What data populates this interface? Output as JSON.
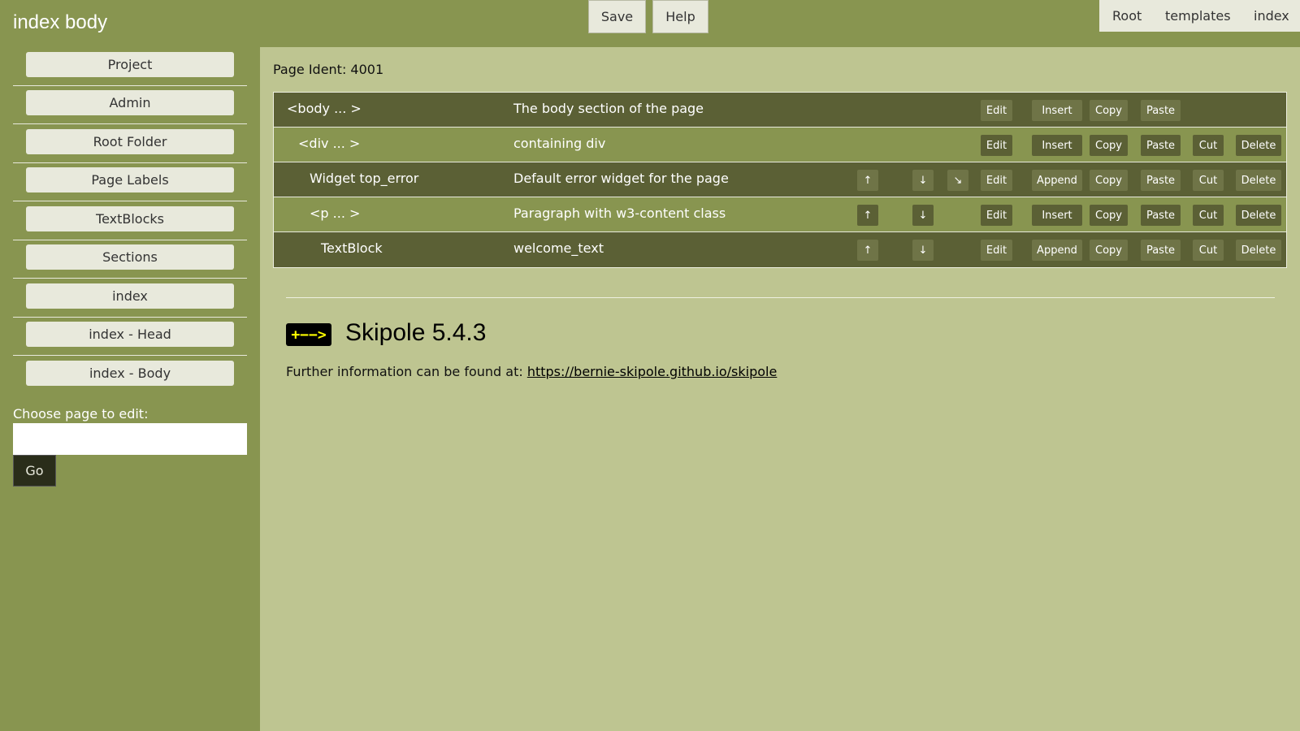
{
  "app_title": "index body",
  "toolbar": {
    "save_label": "Save",
    "help_label": "Help"
  },
  "topnav": {
    "links": [
      "Root",
      "templates",
      "index"
    ]
  },
  "sidebar": {
    "items": [
      {
        "label": "Project"
      },
      {
        "label": "Admin"
      },
      {
        "label": "Root Folder"
      },
      {
        "label": "Page Labels"
      },
      {
        "label": "TextBlocks"
      },
      {
        "label": "Sections"
      },
      {
        "label": "index"
      },
      {
        "label": "index - Head"
      },
      {
        "label": "index - Body"
      }
    ],
    "choose_label": "Choose page to edit:",
    "page_input_value": "",
    "go_label": "Go"
  },
  "main": {
    "page_ident": "Page Ident: 4001",
    "rows": [
      {
        "name": "<body ... >",
        "desc": "The body section of the page"
      },
      {
        "name": "<div ... >",
        "desc": "containing div"
      },
      {
        "name": "Widget top_error",
        "desc": "Default error widget for the page"
      },
      {
        "name": "<p ... >",
        "desc": "Paragraph with w3-content class"
      },
      {
        "name": "TextBlock",
        "desc": "welcome_text"
      }
    ],
    "buttons": {
      "up": "↑",
      "down": "↓",
      "sub": "↘",
      "edit": "Edit",
      "insert": "Insert",
      "append": "Append",
      "copy": "Copy",
      "paste": "Paste",
      "cut": "Cut",
      "delete": "Delete"
    },
    "logo_text": "+−−>",
    "version_title": "Skipole 5.4.3",
    "info_prefix": "Further information can be found at: ",
    "info_link": "https://bernie-skipole.github.io/skipole"
  },
  "colors": {
    "sidebar_bg": "#889550",
    "main_bg": "#bec591",
    "row_dark": "#5b6035",
    "row_light": "#889550",
    "logo_fg": "#ffff00"
  }
}
